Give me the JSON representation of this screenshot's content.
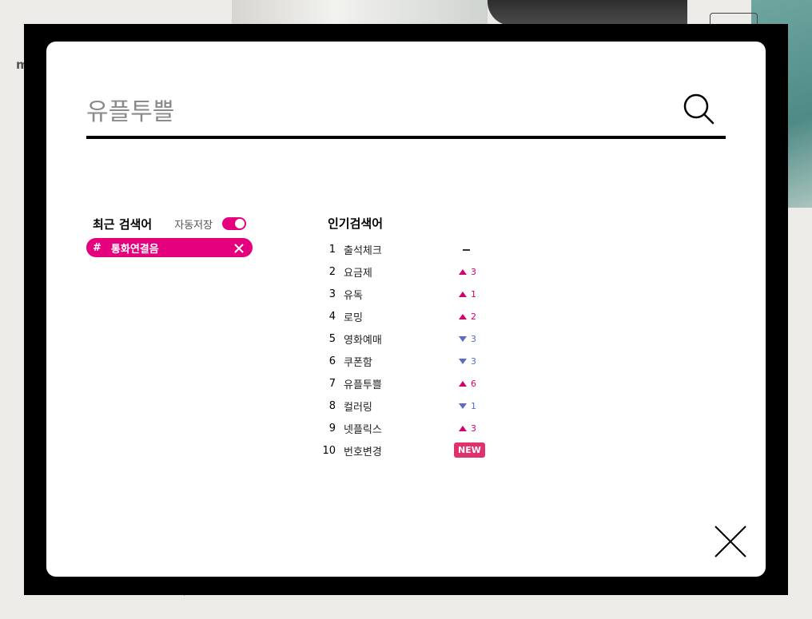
{
  "background": {
    "peek_text": "mple"
  },
  "search": {
    "placeholder": "유플투쁠"
  },
  "recent": {
    "title": "최근 검색어",
    "autosave_label": "자동저장",
    "autosave_on": true,
    "chips": [
      {
        "hash": "#",
        "text": "통화연결음"
      }
    ]
  },
  "popular": {
    "title": "인기검색어",
    "items": [
      {
        "rank": "1",
        "term": "출석체크",
        "change": "same",
        "value": ""
      },
      {
        "rank": "2",
        "term": "요금제",
        "change": "up",
        "value": "3"
      },
      {
        "rank": "3",
        "term": "유독",
        "change": "up",
        "value": "1"
      },
      {
        "rank": "4",
        "term": "로밍",
        "change": "up",
        "value": "2"
      },
      {
        "rank": "5",
        "term": "영화예매",
        "change": "down",
        "value": "3"
      },
      {
        "rank": "6",
        "term": "쿠폰함",
        "change": "down",
        "value": "3"
      },
      {
        "rank": "7",
        "term": "유플투쁠",
        "change": "up",
        "value": "6"
      },
      {
        "rank": "8",
        "term": "컬러링",
        "change": "down",
        "value": "1"
      },
      {
        "rank": "9",
        "term": "넷플릭스",
        "change": "up",
        "value": "3"
      },
      {
        "rank": "10",
        "term": "번호변경",
        "change": "new",
        "value": "NEW"
      }
    ]
  },
  "colors": {
    "accent": "#e5007d",
    "up": "#d4006f",
    "down": "#5b6cc4",
    "overlay": "#000000"
  },
  "icons": {
    "search": "search-icon",
    "close": "close-icon",
    "chip_remove": "x-icon"
  }
}
